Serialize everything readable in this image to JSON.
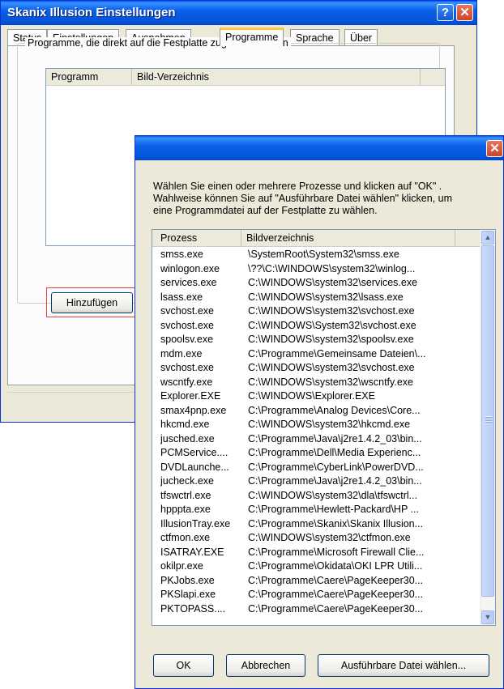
{
  "main_window": {
    "title": "Skanix Illusion Einstellungen",
    "help_glyph": "?",
    "close_glyph": "✕",
    "tabs": [
      {
        "label": "Status"
      },
      {
        "label": "Einstellungen"
      },
      {
        "label": "Ausnahmen"
      },
      {
        "label": "Programme"
      },
      {
        "label": "Sprache"
      },
      {
        "label": "Über"
      }
    ],
    "active_tab": "Programme",
    "group_label": "Programme, die direkt auf die Festplatte zugreifen können",
    "list_columns": [
      "Programm",
      "Bild-Verzeichnis"
    ],
    "add_button": "Hinzufügen"
  },
  "dialog": {
    "close_glyph": "✕",
    "instructions": [
      "Wählen Sie einen oder mehrere Prozesse und klicken auf \"OK\" .",
      "Wahlweise können Sie auf \"Ausführbare Datei wählen\" klicken, um",
      "eine Programmdatei auf der Festplatte zu wählen."
    ],
    "columns": [
      "Prozess",
      "Bildverzeichnis"
    ],
    "rows": [
      {
        "process": "smss.exe",
        "path": "\\SystemRoot\\System32\\smss.exe"
      },
      {
        "process": "winlogon.exe",
        "path": "\\??\\C:\\WINDOWS\\system32\\winlog..."
      },
      {
        "process": "services.exe",
        "path": "C:\\WINDOWS\\system32\\services.exe"
      },
      {
        "process": "lsass.exe",
        "path": "C:\\WINDOWS\\system32\\lsass.exe"
      },
      {
        "process": "svchost.exe",
        "path": "C:\\WINDOWS\\system32\\svchost.exe"
      },
      {
        "process": "svchost.exe",
        "path": "C:\\WINDOWS\\System32\\svchost.exe"
      },
      {
        "process": "spoolsv.exe",
        "path": "C:\\WINDOWS\\system32\\spoolsv.exe"
      },
      {
        "process": "mdm.exe",
        "path": "C:\\Programme\\Gemeinsame Dateien\\..."
      },
      {
        "process": "svchost.exe",
        "path": "C:\\WINDOWS\\system32\\svchost.exe"
      },
      {
        "process": "wscntfy.exe",
        "path": "C:\\WINDOWS\\system32\\wscntfy.exe"
      },
      {
        "process": "Explorer.EXE",
        "path": "C:\\WINDOWS\\Explorer.EXE"
      },
      {
        "process": "smax4pnp.exe",
        "path": "C:\\Programme\\Analog Devices\\Core..."
      },
      {
        "process": "hkcmd.exe",
        "path": "C:\\WINDOWS\\system32\\hkcmd.exe"
      },
      {
        "process": "jusched.exe",
        "path": "C:\\Programme\\Java\\j2re1.4.2_03\\bin..."
      },
      {
        "process": "PCMService....",
        "path": "C:\\Programme\\Dell\\Media Experienc..."
      },
      {
        "process": "DVDLaunche...",
        "path": "C:\\Programme\\CyberLink\\PowerDVD..."
      },
      {
        "process": "jucheck.exe",
        "path": "C:\\Programme\\Java\\j2re1.4.2_03\\bin..."
      },
      {
        "process": "tfswctrl.exe",
        "path": "C:\\WINDOWS\\system32\\dla\\tfswctrl..."
      },
      {
        "process": "hpppta.exe",
        "path": "C:\\Programme\\Hewlett-Packard\\HP ..."
      },
      {
        "process": "IllusionTray.exe",
        "path": "C:\\Programme\\Skanix\\Skanix Illusion..."
      },
      {
        "process": "ctfmon.exe",
        "path": "C:\\WINDOWS\\system32\\ctfmon.exe"
      },
      {
        "process": "ISATRAY.EXE",
        "path": "C:\\Programme\\Microsoft Firewall Clie..."
      },
      {
        "process": "okilpr.exe",
        "path": "C:\\Programme\\Okidata\\OKI LPR Utili..."
      },
      {
        "process": "PKJobs.exe",
        "path": "C:\\Programme\\Caere\\PageKeeper30..."
      },
      {
        "process": "PKSlapi.exe",
        "path": "C:\\Programme\\Caere\\PageKeeper30..."
      },
      {
        "process": "PKTOPASS....",
        "path": "C:\\Programme\\Caere\\PageKeeper30..."
      }
    ],
    "scroll_up_glyph": "▲",
    "scroll_down_glyph": "▼",
    "ok_button": "OK",
    "cancel_button": "Abbrechen",
    "choose_exe_button": "Ausführbare Datei wählen..."
  },
  "colors": {
    "title_bar": "#0453d8",
    "window_face": "#ece9d8",
    "highlight_outline": "#e84030"
  }
}
